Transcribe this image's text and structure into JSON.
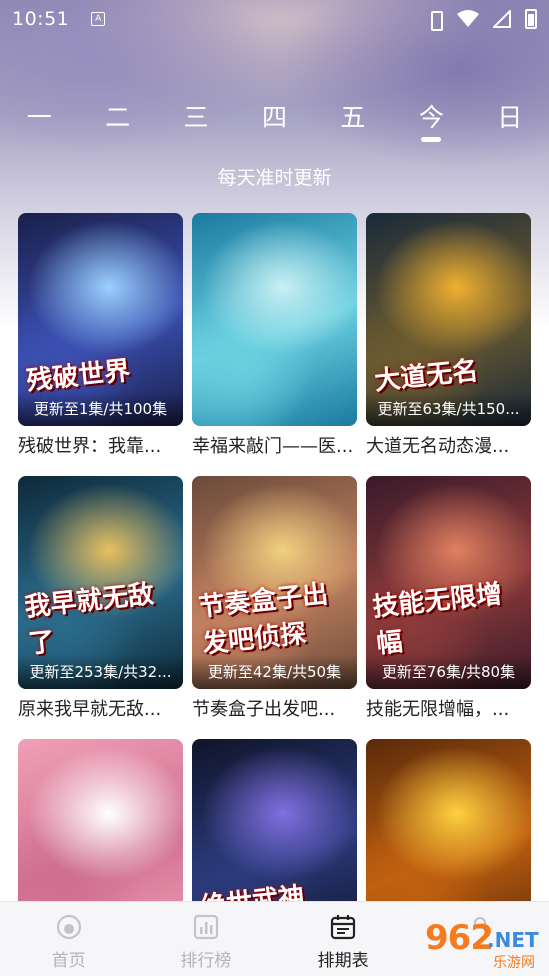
{
  "status_bar": {
    "time": "10:51",
    "notif_letter": "A"
  },
  "day_tabs": [
    {
      "label": "一",
      "active": false
    },
    {
      "label": "二",
      "active": false
    },
    {
      "label": "三",
      "active": false
    },
    {
      "label": "四",
      "active": false
    },
    {
      "label": "五",
      "active": false
    },
    {
      "label": "今",
      "active": true
    },
    {
      "label": "日",
      "active": false
    }
  ],
  "subtitle": "每天准时更新",
  "cards": [
    {
      "title": "残破世界：我靠...",
      "episode": "更新至1集/共100集",
      "cover_text": "残破世界",
      "colors": [
        "#1a1f4a",
        "#3a4fb0",
        "#9ad0ff"
      ]
    },
    {
      "title": "幸福来敲门——医...",
      "episode": "",
      "cover_text": "",
      "colors": [
        "#1a7aa0",
        "#6ad0e0",
        "#c8f0f4"
      ]
    },
    {
      "title": "大道无名动态漫...",
      "episode": "更新至63集/共150...",
      "cover_text": "大道无名",
      "colors": [
        "#1a2a3a",
        "#6a5a30",
        "#f0b030"
      ]
    },
    {
      "title": "原来我早就无敌...",
      "episode": "更新至253集/共32...",
      "cover_text": "我早就无敌了",
      "colors": [
        "#0e2a3a",
        "#2a6a8a",
        "#e8c060"
      ]
    },
    {
      "title": "节奏盒子出发吧...",
      "episode": "更新至42集/共50集",
      "cover_text": "节奏盒子出发吧侦探",
      "colors": [
        "#6a4a3a",
        "#c08060",
        "#f0d080"
      ]
    },
    {
      "title": "技能无限增幅，...",
      "episode": "更新至76集/共80集",
      "cover_text": "技能无限增幅",
      "colors": [
        "#3a1a2a",
        "#8a3a3a",
        "#e08060"
      ]
    },
    {
      "title": "",
      "episode": "",
      "cover_text": "",
      "colors": [
        "#f0a0b8",
        "#d07090",
        "#ffffff"
      ]
    },
    {
      "title": "",
      "episode": "",
      "cover_text": "绝世武神",
      "colors": [
        "#10142a",
        "#2a3a7a",
        "#8070e0"
      ]
    },
    {
      "title": "",
      "episode": "",
      "cover_text": "",
      "colors": [
        "#5a2a0a",
        "#c06010",
        "#ffd040"
      ]
    }
  ],
  "bottom_nav": [
    {
      "label": "首页",
      "icon": "home-icon",
      "active": false
    },
    {
      "label": "排行榜",
      "icon": "ranking-icon",
      "active": false
    },
    {
      "label": "排期表",
      "icon": "calendar-icon",
      "active": true
    },
    {
      "label": "",
      "icon": "profile-icon",
      "active": false
    }
  ],
  "watermark": {
    "number": "962",
    "net": ".NET",
    "sub": "乐游网"
  }
}
